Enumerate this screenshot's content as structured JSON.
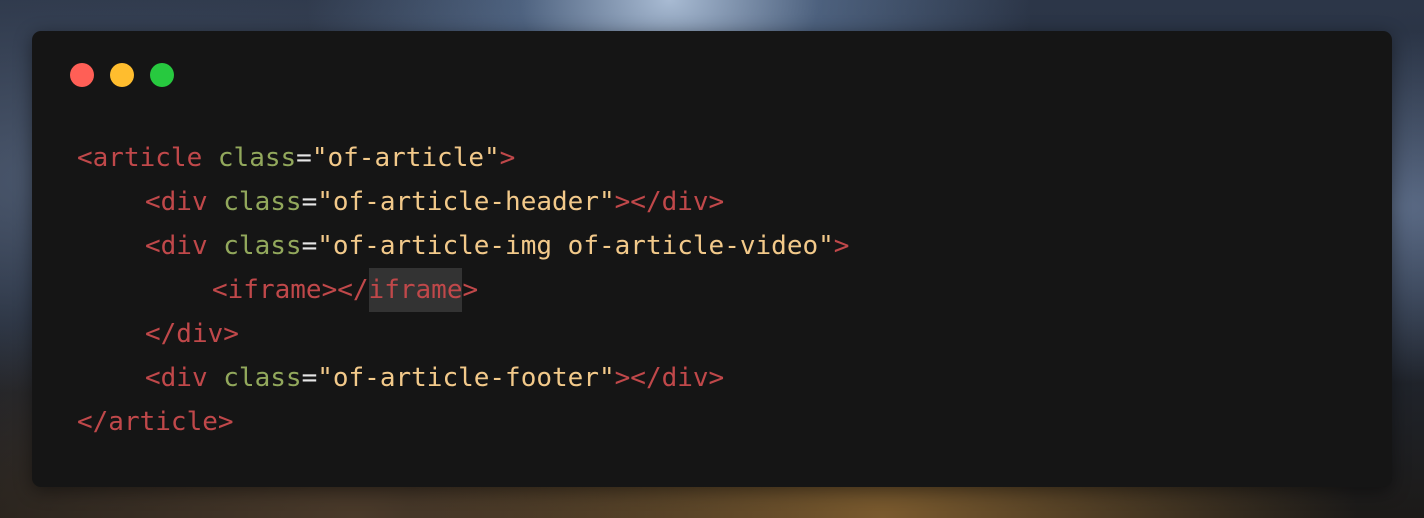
{
  "window": {
    "controls": {
      "close_color": "#ff5f56",
      "minimize_color": "#ffbd2e",
      "maximize_color": "#27c93f"
    }
  },
  "code": {
    "colors": {
      "tag": "#c0484a",
      "attribute": "#92a85c",
      "string": "#f2c98a",
      "text": "#e6e6e6",
      "background": "#151515"
    },
    "line1": {
      "open": "<article",
      "attr": "class",
      "eq": "=",
      "value": "\"of-article\"",
      "close": ">"
    },
    "line2": {
      "open": "<div",
      "attr": "class",
      "eq": "=",
      "value": "\"of-article-header\"",
      "close": "></div>"
    },
    "line3": {
      "open": "<div",
      "attr": "class",
      "eq": "=",
      "value": "\"of-article-img of-article-video\"",
      "close": ">"
    },
    "line4": {
      "open": "<iframe></",
      "highlighted": "iframe",
      "close": ">"
    },
    "line5": {
      "text": "</div>"
    },
    "line6": {
      "open": "<div",
      "attr": "class",
      "eq": "=",
      "value": "\"of-article-footer\"",
      "close": "></div>"
    },
    "line7": {
      "text": "</article>"
    }
  }
}
